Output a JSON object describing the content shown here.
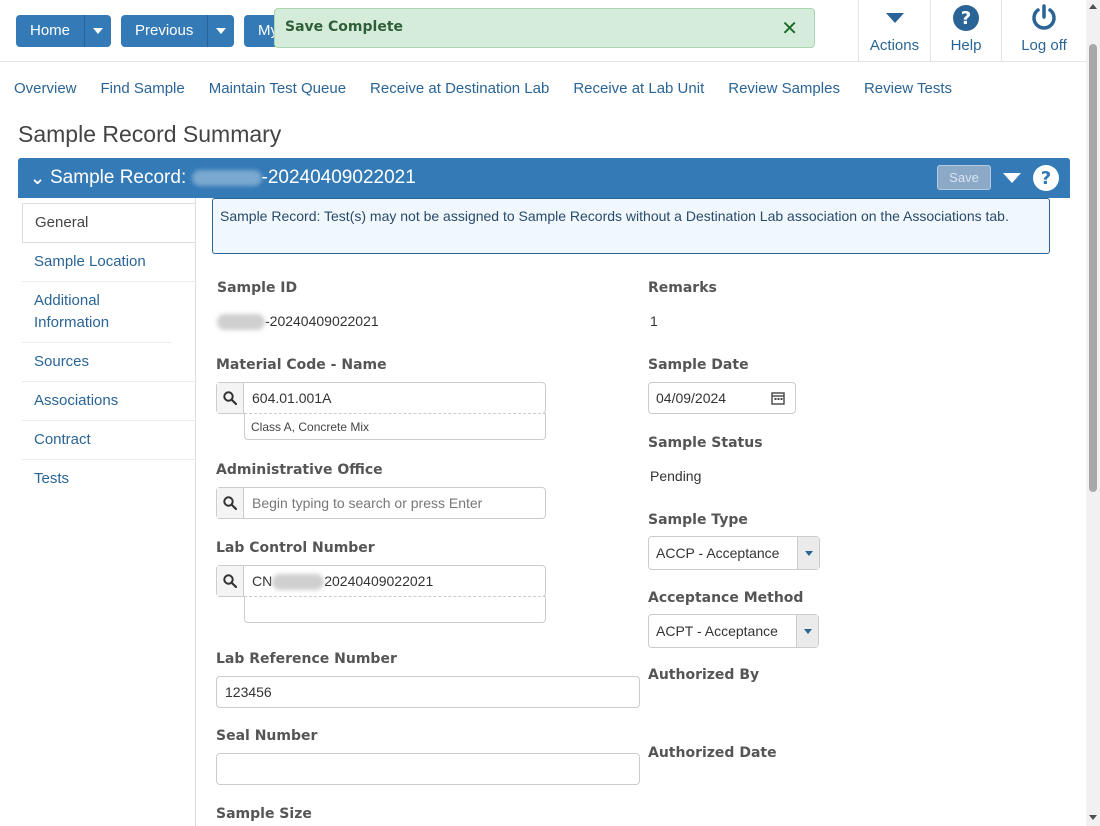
{
  "topbar": {
    "home_label": "Home",
    "previous_label": "Previous",
    "my_label_partial": "My",
    "toast_message": "Save Complete",
    "toast_close": "✕",
    "actions_label": "Actions",
    "help_label": "Help",
    "logoff_label": "Log off"
  },
  "nav": {
    "items": [
      "Overview",
      "Find Sample",
      "Maintain Test Queue",
      "Receive at Destination Lab",
      "Receive at Lab Unit",
      "Review Samples",
      "Review Tests"
    ]
  },
  "page_title": "Sample Record Summary",
  "panel": {
    "title_prefix": "Sample Record: ",
    "title_suffix": "-20240409022021",
    "save_label": "Save"
  },
  "side_tabs": [
    "General",
    "Sample Location",
    "Additional Information",
    "Sources",
    "Associations",
    "Contract",
    "Tests"
  ],
  "alert_text": "Sample Record: Test(s) may not be assigned to Sample Records without a Destination Lab association on the Associations tab.",
  "form": {
    "sample_id_label": "Sample ID",
    "sample_id_suffix": "-20240409022021",
    "material_label": "Material Code - Name",
    "material_code": "604.01.001A",
    "material_name": "Class A, Concrete Mix",
    "admin_office_label": "Administrative Office",
    "admin_office_placeholder": "Begin typing to search or press Enter",
    "lab_control_label": "Lab Control Number",
    "lab_control_prefix": "CN",
    "lab_control_suffix": "20240409022021",
    "lab_ref_label": "Lab Reference Number",
    "lab_ref_value": "123456",
    "seal_label": "Seal Number",
    "seal_value": "",
    "sample_size_label": "Sample Size",
    "remarks_label": "Remarks",
    "remarks_value": "1",
    "sample_date_label": "Sample Date",
    "sample_date_value": "04/09/2024",
    "sample_status_label": "Sample Status",
    "sample_status_value": "Pending",
    "sample_type_label": "Sample Type",
    "sample_type_value": "ACCP - Acceptance",
    "acceptance_method_label": "Acceptance Method",
    "acceptance_method_value": "ACPT - Acceptance",
    "authorized_by_label": "Authorized By",
    "authorized_date_label": "Authorized Date"
  }
}
